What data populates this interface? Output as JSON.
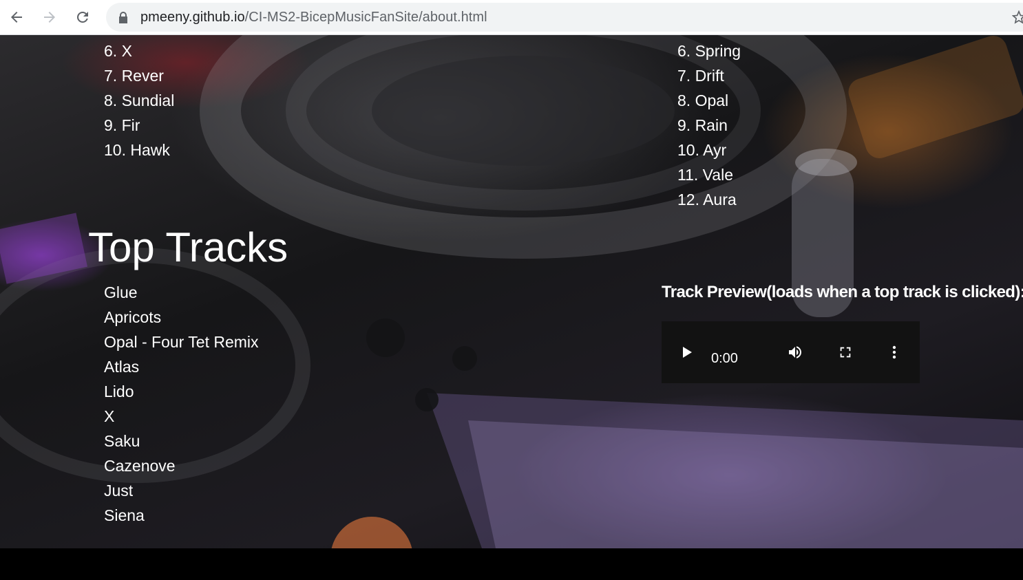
{
  "browser": {
    "url_host": "pmeeny.github.io",
    "url_path": "/CI-MS2-BicepMusicFanSite/about.html"
  },
  "album_one_tracks": [
    "6. X",
    "7. Rever",
    "8. Sundial",
    "9. Fir",
    "10. Hawk"
  ],
  "album_two_tracks": [
    "6. Spring",
    "7. Drift",
    "8. Opal",
    "9. Rain",
    "10. Ayr",
    "11. Vale",
    "12. Aura"
  ],
  "top_tracks": {
    "title": "Top Tracks",
    "items": [
      "Glue",
      "Apricots",
      "Opal - Four Tet Remix",
      "Atlas",
      "Lido",
      "X",
      "Saku",
      "Cazenove",
      "Just",
      "Siena"
    ]
  },
  "preview": {
    "label": "Track Preview(loads when a top track is clicked):",
    "time": "0:00"
  },
  "icons": [
    "back-icon",
    "forward-icon",
    "reload-icon",
    "lock-icon",
    "bookmark-star-icon",
    "play-icon",
    "volume-icon",
    "fullscreen-icon",
    "more-options-icon"
  ]
}
